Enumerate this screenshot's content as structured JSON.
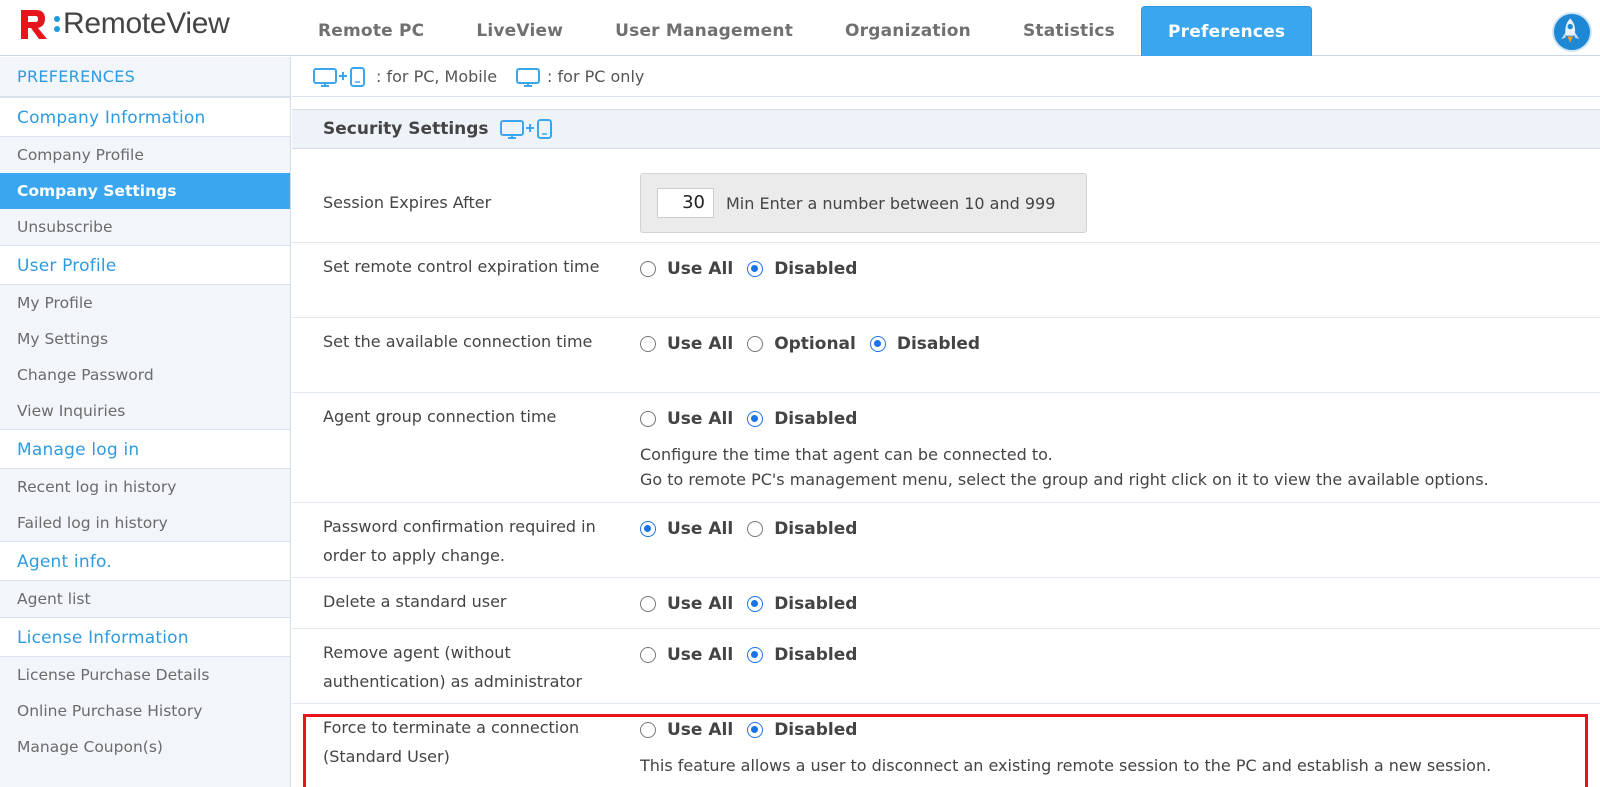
{
  "app": {
    "logo_text": "RemoteView"
  },
  "nav": {
    "tabs": [
      "Remote PC",
      "LiveView",
      "User Management",
      "Organization",
      "Statistics",
      "Preferences"
    ],
    "active": "Preferences"
  },
  "sidebar": {
    "heading": "PREFERENCES",
    "sections": [
      {
        "title": "Company Information",
        "items": [
          "Company Profile",
          "Company Settings",
          "Unsubscribe"
        ]
      },
      {
        "title": "User Profile",
        "items": [
          "My Profile",
          "My Settings",
          "Change Password",
          "View Inquiries"
        ]
      },
      {
        "title": "Manage log in",
        "items": [
          "Recent log in history",
          "Failed log in history"
        ]
      },
      {
        "title": "Agent info.",
        "items": [
          "Agent list"
        ]
      },
      {
        "title": "License Information",
        "items": [
          "License Purchase Details",
          "Online Purchase History",
          "Manage Coupon(s)"
        ]
      }
    ],
    "active_item": "Company Settings"
  },
  "legend": {
    "pc_mobile": ": for PC, Mobile",
    "pc_only": ": for PC only"
  },
  "section": {
    "title": "Security Settings"
  },
  "settings": {
    "session": {
      "label": "Session Expires After",
      "value": "30",
      "hint": "Min Enter a number between 10 and 999"
    },
    "rows": [
      {
        "label": "Set remote control expiration time",
        "options": [
          "Use All",
          "Disabled"
        ],
        "selected": "Disabled"
      },
      {
        "label": "Set the available connection time",
        "options": [
          "Use All",
          "Optional",
          "Disabled"
        ],
        "selected": "Disabled"
      },
      {
        "label": "Agent group connection time",
        "options": [
          "Use All",
          "Disabled"
        ],
        "selected": "Disabled",
        "desc1": "Configure the time that agent can be connected to.",
        "desc2": "Go to remote PC's management menu, select the group and right click on it to view the available options."
      },
      {
        "label": "Password confirmation required in order to apply change.",
        "options": [
          "Use All",
          "Disabled"
        ],
        "selected": "Use All"
      },
      {
        "label": "Delete a standard user",
        "options": [
          "Use All",
          "Disabled"
        ],
        "selected": "Disabled"
      },
      {
        "label": "Remove agent (without authentication) as administrator",
        "options": [
          "Use All",
          "Disabled"
        ],
        "selected": "Disabled"
      },
      {
        "label": "Force to terminate a connection (Standard User)",
        "options": [
          "Use All",
          "Disabled"
        ],
        "selected": "Disabled",
        "desc1": "This feature allows a user to disconnect an existing remote session to the PC and establish a new session."
      }
    ]
  },
  "colors": {
    "accent": "#3aa6ef",
    "link": "#2d9be0",
    "highlight": "#e8141b"
  },
  "icons": {
    "pc_mobile": "monitor-plus-mobile-icon",
    "pc_only": "monitor-icon"
  }
}
